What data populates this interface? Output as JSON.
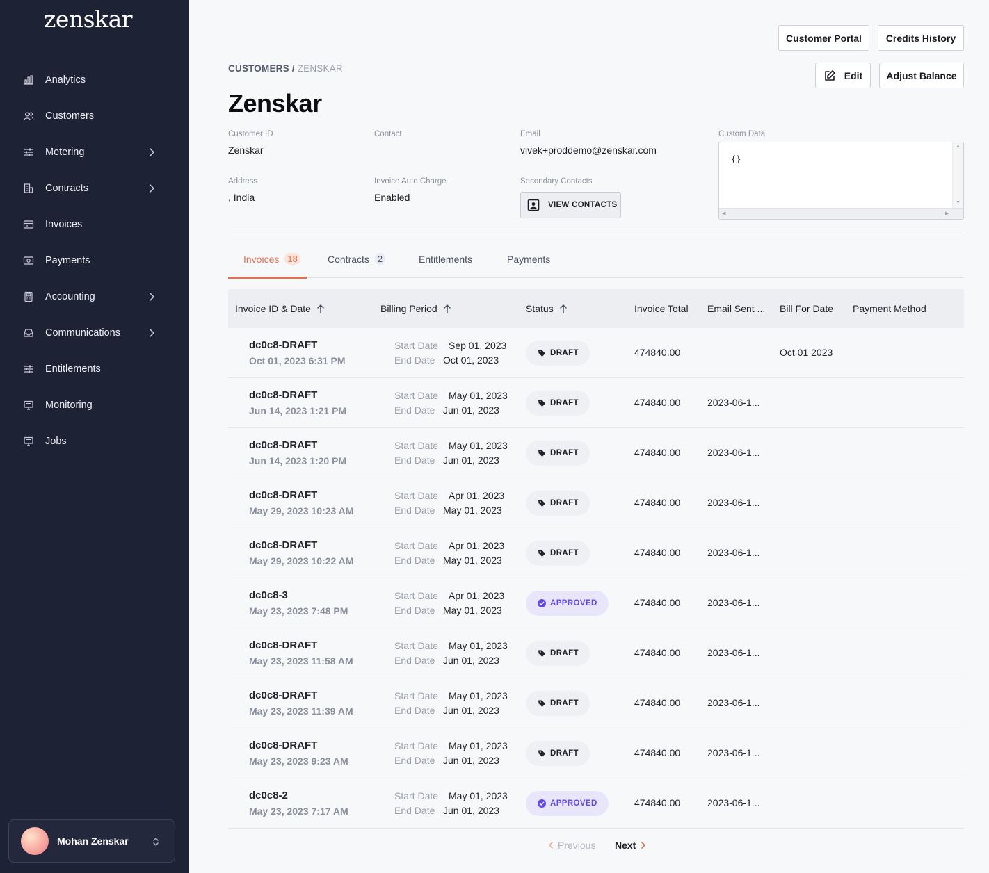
{
  "app": {
    "logo": "zenskar"
  },
  "sidebar": {
    "items": [
      {
        "label": "Analytics",
        "icon": "bar-chart-icon",
        "has_arrow": false
      },
      {
        "label": "Customers",
        "icon": "users-icon",
        "has_arrow": false
      },
      {
        "label": "Metering",
        "icon": "sliders-icon",
        "has_arrow": true
      },
      {
        "label": "Contracts",
        "icon": "building-icon",
        "has_arrow": true
      },
      {
        "label": "Invoices",
        "icon": "credit-card-icon",
        "has_arrow": false
      },
      {
        "label": "Payments",
        "icon": "money-icon",
        "has_arrow": false
      },
      {
        "label": "Accounting",
        "icon": "calculator-icon",
        "has_arrow": true
      },
      {
        "label": "Communications",
        "icon": "inbox-icon",
        "has_arrow": true
      },
      {
        "label": "Entitlements",
        "icon": "sliders-icon",
        "has_arrow": false
      },
      {
        "label": "Monitoring",
        "icon": "monitor-icon",
        "has_arrow": false
      },
      {
        "label": "Jobs",
        "icon": "monitor-icon",
        "has_arrow": false
      }
    ],
    "user": {
      "name": "Mohan Zenskar"
    }
  },
  "header": {
    "buttons": {
      "customer_portal": "Customer Portal",
      "credits_history": "Credits History",
      "edit": "Edit",
      "adjust_balance": "Adjust Balance"
    },
    "breadcrumb": {
      "root": "CUSTOMERS /",
      "current": "ZENSKAR"
    },
    "title": "Zenskar"
  },
  "details": {
    "customer_id": {
      "label": "Customer ID",
      "value": "Zenskar"
    },
    "contact": {
      "label": "Contact",
      "value": ""
    },
    "email": {
      "label": "Email",
      "value": "vivek+proddemo@zenskar.com"
    },
    "custom_data": {
      "label": "Custom Data",
      "value": "{}"
    },
    "address": {
      "label": "Address",
      "value": ", India"
    },
    "auto_charge": {
      "label": "Invoice Auto Charge",
      "value": "Enabled"
    },
    "secondary_contacts": {
      "label": "Secondary Contacts",
      "button": "VIEW CONTACTS"
    }
  },
  "tabs": [
    {
      "label": "Invoices",
      "count": "18",
      "active": true
    },
    {
      "label": "Contracts",
      "count": "2",
      "active": false
    },
    {
      "label": "Entitlements",
      "count": "",
      "active": false
    },
    {
      "label": "Payments",
      "count": "",
      "active": false
    }
  ],
  "table": {
    "headers": [
      "Invoice ID & Date",
      "Billing Period",
      "Status",
      "Invoice Total",
      "Email Sent ...",
      "Bill For Date",
      "Payment Method"
    ],
    "start_label": "Start Date",
    "end_label": "End Date",
    "rows": [
      {
        "id": "dc0c8-DRAFT",
        "date": "Oct 01, 2023 6:31 PM",
        "start": "Sep 01, 2023",
        "end": "Oct 01, 2023",
        "status": "DRAFT",
        "total": "474840.00",
        "email_sent": "",
        "bill_for": "Oct 01 2023",
        "payment_method": ""
      },
      {
        "id": "dc0c8-DRAFT",
        "date": "Jun 14, 2023 1:21 PM",
        "start": "May 01, 2023",
        "end": "Jun 01, 2023",
        "status": "DRAFT",
        "total": "474840.00",
        "email_sent": "2023-06-1...",
        "bill_for": "",
        "payment_method": ""
      },
      {
        "id": "dc0c8-DRAFT",
        "date": "Jun 14, 2023 1:20 PM",
        "start": "May 01, 2023",
        "end": "Jun 01, 2023",
        "status": "DRAFT",
        "total": "474840.00",
        "email_sent": "2023-06-1...",
        "bill_for": "",
        "payment_method": ""
      },
      {
        "id": "dc0c8-DRAFT",
        "date": "May 29, 2023 10:23 AM",
        "start": "Apr 01, 2023",
        "end": "May 01, 2023",
        "status": "DRAFT",
        "total": "474840.00",
        "email_sent": "2023-06-1...",
        "bill_for": "",
        "payment_method": ""
      },
      {
        "id": "dc0c8-DRAFT",
        "date": "May 29, 2023 10:22 AM",
        "start": "Apr 01, 2023",
        "end": "May 01, 2023",
        "status": "DRAFT",
        "total": "474840.00",
        "email_sent": "2023-06-1...",
        "bill_for": "",
        "payment_method": ""
      },
      {
        "id": "dc0c8-3",
        "date": "May 23, 2023 7:48 PM",
        "start": "Apr 01, 2023",
        "end": "May 01, 2023",
        "status": "APPROVED",
        "total": "474840.00",
        "email_sent": "2023-06-1...",
        "bill_for": "",
        "payment_method": ""
      },
      {
        "id": "dc0c8-DRAFT",
        "date": "May 23, 2023 11:58 AM",
        "start": "May 01, 2023",
        "end": "Jun 01, 2023",
        "status": "DRAFT",
        "total": "474840.00",
        "email_sent": "2023-06-1...",
        "bill_for": "",
        "payment_method": ""
      },
      {
        "id": "dc0c8-DRAFT",
        "date": "May 23, 2023 11:39 AM",
        "start": "May 01, 2023",
        "end": "Jun 01, 2023",
        "status": "DRAFT",
        "total": "474840.00",
        "email_sent": "2023-06-1...",
        "bill_for": "",
        "payment_method": ""
      },
      {
        "id": "dc0c8-DRAFT",
        "date": "May 23, 2023 9:23 AM",
        "start": "May 01, 2023",
        "end": "Jun 01, 2023",
        "status": "DRAFT",
        "total": "474840.00",
        "email_sent": "2023-06-1...",
        "bill_for": "",
        "payment_method": ""
      },
      {
        "id": "dc0c8-2",
        "date": "May 23, 2023 7:17 AM",
        "start": "May 01, 2023",
        "end": "Jun 01, 2023",
        "status": "APPROVED",
        "total": "474840.00",
        "email_sent": "2023-06-1...",
        "bill_for": "",
        "payment_method": ""
      }
    ]
  },
  "pagination": {
    "previous": "Previous",
    "next": "Next"
  },
  "colors": {
    "accent": "#e5704f",
    "sidebar_bg": "#1e2235",
    "approved": "#6548e6"
  }
}
